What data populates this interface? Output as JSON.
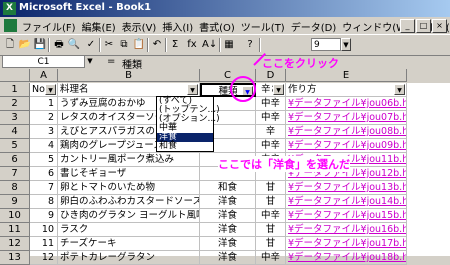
{
  "window": {
    "title": "Microsoft Excel - Book1",
    "app_icon": "X"
  },
  "menubar": {
    "items": [
      "ファイル(F)",
      "編集(E)",
      "表示(V)",
      "挿入(I)",
      "書式(O)",
      "ツール(T)",
      "データ(D)",
      "ウィンドウ(W)",
      "ヘルプ(H)"
    ],
    "window_buttons": [
      "_",
      "□",
      "×"
    ]
  },
  "toolbar": {
    "icons": [
      "new-icon",
      "open-icon",
      "save-icon",
      "print-icon",
      "preview-icon",
      "spell-icon",
      "cut-icon",
      "copy-icon",
      "paste-icon",
      "undo-icon",
      "sum-icon",
      "function-icon",
      "sort-asc-icon",
      "chart-icon",
      "help-icon"
    ],
    "glyphs": [
      "🗋",
      "📂",
      "💾",
      "🖶",
      "🔍",
      "✓",
      "✂",
      "⧉",
      "📋",
      "↶",
      "Σ",
      "fx",
      "A↓",
      "▦",
      "?"
    ],
    "zoom_value": "9"
  },
  "formula_bar": {
    "name_box": "C1",
    "equals": "=",
    "value": "種類"
  },
  "annotations": {
    "click_here": "ここをクリック",
    "chose_western": "ここでは「洋食」を選んだ"
  },
  "columns": [
    "A",
    "B",
    "C",
    "D",
    "E"
  ],
  "header_row": {
    "a": "No",
    "b": "料理名",
    "c": "種類",
    "d": "辛さ",
    "e": "作り方"
  },
  "rows": [
    {
      "num": "2",
      "a": "1",
      "b": "うずみ豆腐のおかゆ",
      "c": "",
      "d": "中辛",
      "e": "¥データファイル¥jou06b.html"
    },
    {
      "num": "3",
      "a": "2",
      "b": "レタスのオイスターソースが",
      "c": "",
      "d": "中辛",
      "e": "¥データファイル¥jou07b.html"
    },
    {
      "num": "4",
      "a": "3",
      "b": "えびとアスパラガスのピリ",
      "c": "",
      "d": "辛",
      "e": "¥データファイル¥jou08b.html"
    },
    {
      "num": "5",
      "a": "4",
      "b": "鶏肉のグレープジュース煮",
      "c": "",
      "d": "中辛",
      "e": "¥データファイル¥jou09b.html"
    },
    {
      "num": "6",
      "a": "5",
      "b": "カントリー風ポーク煮込み",
      "c": "",
      "d": "中辛",
      "e": "¥データファイル¥jou11b.html"
    },
    {
      "num": "7",
      "a": "6",
      "b": "書じそギョーザ",
      "c": "",
      "d": "",
      "e": "¥データファイル¥jou12b.html"
    },
    {
      "num": "8",
      "a": "7",
      "b": "卵とトマトのいため物",
      "c": "和食",
      "d": "甘",
      "e": "¥データファイル¥jou13b.html"
    },
    {
      "num": "9",
      "a": "8",
      "b": "卵白のふわふわカスタードソース",
      "c": "洋食",
      "d": "甘",
      "e": "¥データファイル¥jou14b.html"
    },
    {
      "num": "10",
      "a": "9",
      "b": "ひき肉のグラタン ヨーグルト風味",
      "c": "洋食",
      "d": "中辛",
      "e": "¥データファイル¥jou15b.html"
    },
    {
      "num": "11",
      "a": "10",
      "b": "ラスク",
      "c": "洋食",
      "d": "甘",
      "e": "¥データファイル¥jou16b.html"
    },
    {
      "num": "12",
      "a": "11",
      "b": "チーズケーキ",
      "c": "洋食",
      "d": "甘",
      "e": "¥データファイル¥jou17b.html"
    },
    {
      "num": "13",
      "a": "12",
      "b": "ポテトカレーグラタン",
      "c": "洋食",
      "d": "中辛",
      "e": "¥データファイル¥jou18b.html"
    }
  ],
  "filter_dropdown": {
    "options": [
      "(すべて)",
      "(トップテン...)",
      "(オプション...)",
      "中華",
      "洋食",
      "和食"
    ],
    "selected": "洋食"
  },
  "colors": {
    "annotation": "#ff00ff",
    "selection": "#0a246a",
    "link": "#cc00cc"
  }
}
